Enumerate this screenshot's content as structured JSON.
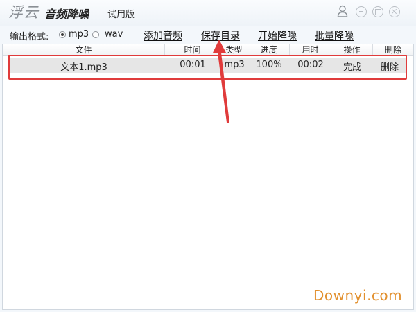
{
  "title_bar": {
    "logo": "浮云",
    "product": "音频降噪",
    "edition": "试用版"
  },
  "toolbar": {
    "format_label": "输出格式:",
    "format_options": [
      "mp3",
      "wav"
    ],
    "selected_format": "mp3",
    "links": {
      "add_audio": "添加音频",
      "save_dir": "保存目录",
      "start": "开始降噪",
      "batch": "批量降噪"
    }
  },
  "table": {
    "columns": [
      "文件",
      "时间",
      "类型",
      "进度",
      "用时",
      "操作",
      "删除"
    ],
    "rows": [
      {
        "file": "文本1.mp3",
        "time": "00:01",
        "type": "mp3",
        "progress": "100%",
        "used": "00:02",
        "action": "完成",
        "delete": "删除"
      }
    ]
  },
  "annotation_color": "#e03b3b",
  "watermark": "Downyi.com",
  "watermark_color": "#e2902e"
}
